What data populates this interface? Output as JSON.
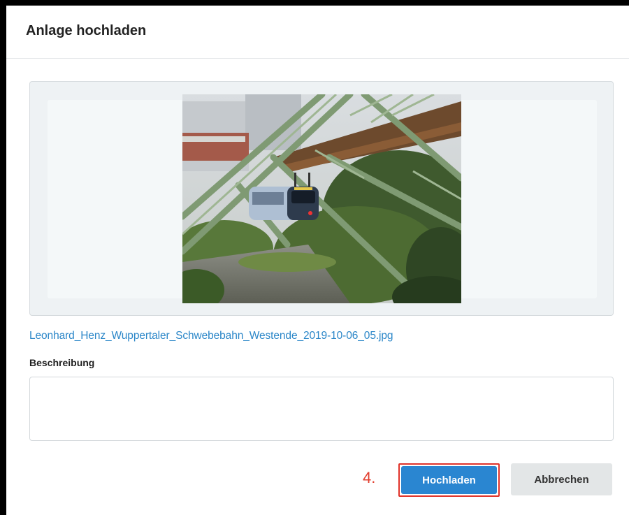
{
  "dialog": {
    "title": "Anlage hochladen"
  },
  "preview": {
    "image_alt": "Wuppertaler Schwebebahn"
  },
  "file": {
    "name": "Leonhard_Henz_Wuppertaler_Schwebebahn_Westende_2019-10-06_05.jpg"
  },
  "description": {
    "label": "Beschreibung",
    "value": "",
    "placeholder": ""
  },
  "annotation": {
    "step": "4."
  },
  "buttons": {
    "upload_label": "Hochladen",
    "cancel_label": "Abbrechen"
  },
  "colors": {
    "link": "#2a86c8",
    "primary": "#2a86d1",
    "highlight": "#e0332a"
  }
}
